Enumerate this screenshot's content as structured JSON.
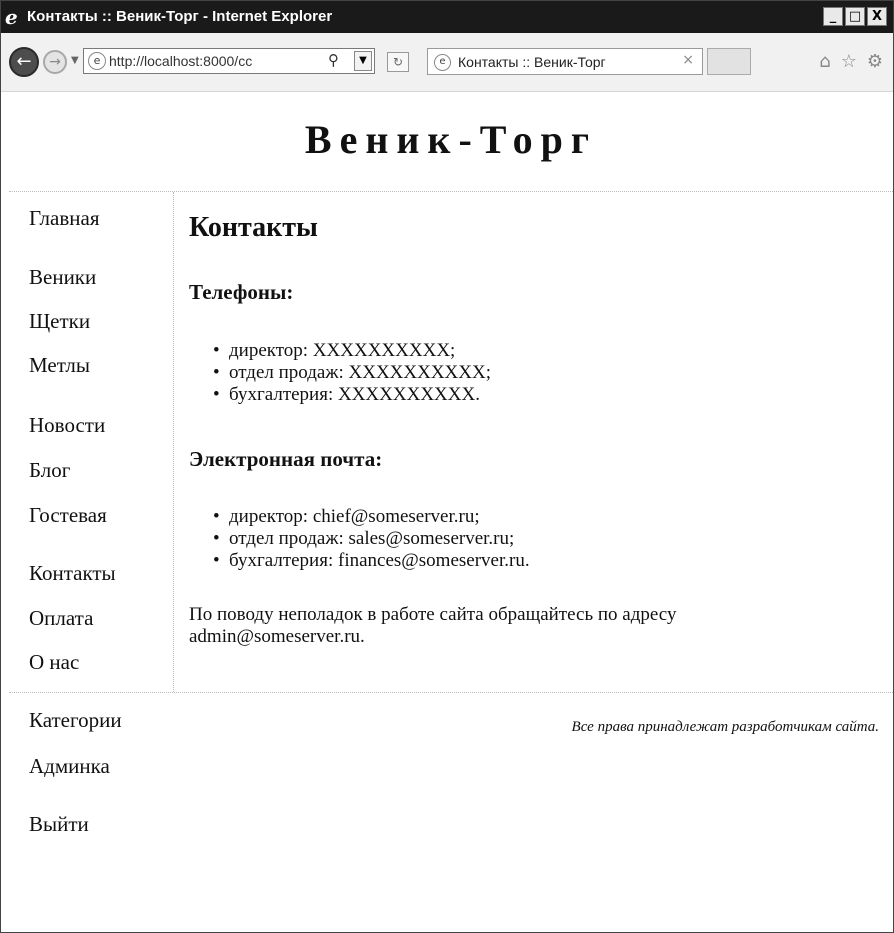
{
  "window": {
    "title": "Контакты :: Веник-Торг - Internet Explorer",
    "controls": {
      "minimize": "_",
      "maximize": "□",
      "close": "X"
    }
  },
  "toolbar": {
    "address": "http://localhost:8000/cc",
    "tab_title": "Контакты :: Веник-Торг",
    "tab_close": "×"
  },
  "site": {
    "title": "Веник-Торг"
  },
  "sidebar": {
    "items": [
      {
        "label": "Главная"
      },
      {
        "label": "Веники"
      },
      {
        "label": "Щетки"
      },
      {
        "label": "Метлы"
      },
      {
        "label": "Новости"
      },
      {
        "label": "Блог"
      },
      {
        "label": "Гостевая"
      },
      {
        "label": "Контакты"
      },
      {
        "label": "Оплата"
      },
      {
        "label": "О нас"
      },
      {
        "label": "Категории"
      },
      {
        "label": "Админка"
      },
      {
        "label": "Выйти"
      }
    ]
  },
  "content": {
    "heading": "Контакты",
    "phones": {
      "heading": "Телефоны:",
      "items": [
        "директор: XXXXXXXXXX;",
        "отдел продаж: XXXXXXXXXX;",
        "бухгалтерия: XXXXXXXXXX."
      ]
    },
    "emails": {
      "heading": "Электронная почта:",
      "items": [
        "директор: chief@someserver.ru;",
        "отдел продаж: sales@someserver.ru;",
        "бухгалтерия: finances@someserver.ru."
      ]
    },
    "note": "По поводу неполадок в работе сайта обращайтесь по адресу admin@someserver.ru."
  },
  "footer": {
    "copyright": "Все права принадлежат разработчикам сайта."
  }
}
